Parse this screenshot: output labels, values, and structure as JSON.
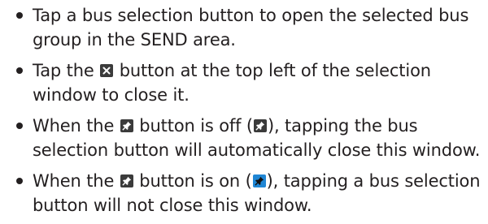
{
  "items": [
    {
      "text": "Tap a bus selection button to open the selected bus group in the SEND area."
    },
    {
      "text_before": "Tap the ",
      "icon": "close-icon",
      "text_after": " button at the top left of the selection window to close it."
    },
    {
      "text_before": "When the ",
      "icon": "pin-icon",
      "text_middle": " button is off (",
      "icon_state": "pin-off-icon",
      "text_after": "), tapping the bus selection button will automatically close this window."
    },
    {
      "text_before": "When the ",
      "icon": "pin-icon",
      "text_middle": " button is on (",
      "icon_state": "pin-on-icon",
      "text_after": "), tapping a bus selection button will not close this window."
    }
  ],
  "colors": {
    "text": "#231f20",
    "icon_dark": "#3b3b3b",
    "icon_on": "#1f86d4"
  }
}
